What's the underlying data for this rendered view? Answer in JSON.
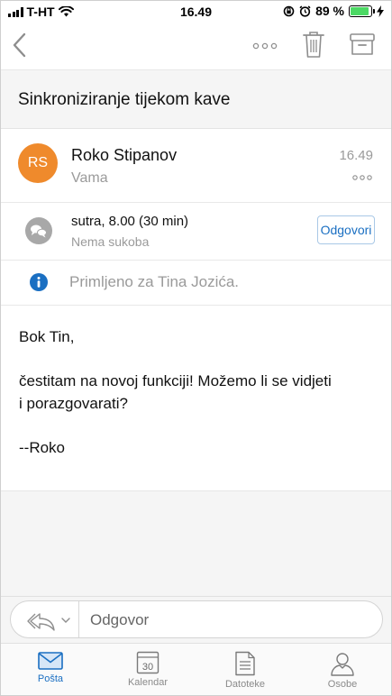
{
  "status_bar": {
    "carrier": "T-HT",
    "time": "16.49",
    "battery_percent": "89 %"
  },
  "message": {
    "subject": "Sinkroniziranje tijekom kave",
    "sender": {
      "initials": "RS",
      "name": "Roko Stipanov",
      "recipient": "Vama",
      "time": "16.49",
      "avatar_color": "#ef8a2c"
    },
    "meeting": {
      "when": "sutra, 8.00 (30 min)",
      "conflict": "Nema sukoba",
      "reply_label": "Odgovori"
    },
    "info": "Primljeno za Tina Jozića.",
    "body": {
      "greeting": "Bok Tin,",
      "line1": "čestitam na novoj funkciji! Možemo li se vidjeti",
      "line2": "i porazgovarati?",
      "signature": "--Roko"
    }
  },
  "compose": {
    "placeholder": "Odgovor"
  },
  "tabs": [
    {
      "label": "Pošta",
      "icon": "mail-icon",
      "active": true
    },
    {
      "label": "Kalendar",
      "icon": "calendar-icon",
      "day": "30"
    },
    {
      "label": "Datoteke",
      "icon": "files-icon"
    },
    {
      "label": "Osobe",
      "icon": "people-icon"
    }
  ],
  "colors": {
    "accent": "#1a6fc2",
    "battery": "#4cd964",
    "info": "#1a6fc2"
  }
}
